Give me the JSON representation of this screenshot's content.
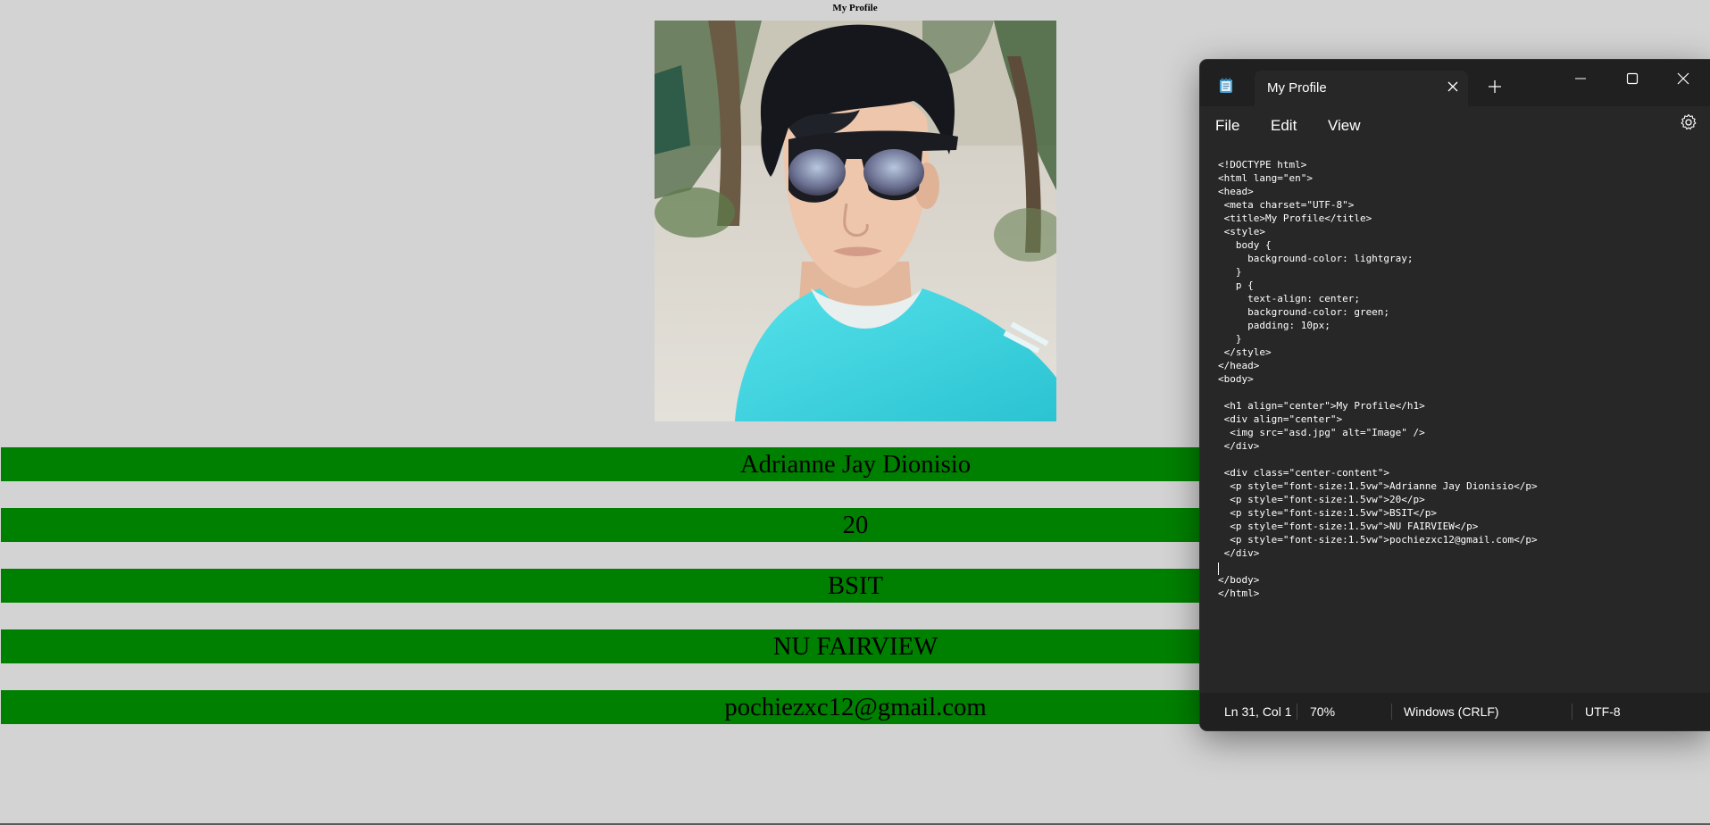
{
  "page": {
    "heading": "My Profile",
    "image_alt": "Image",
    "info": [
      "Adrianne Jay Dionisio",
      "20",
      "BSIT",
      "NU FAIRVIEW",
      "pochiezxc12@gmail.com"
    ],
    "bar_color": "#008000",
    "background_color": "#d3d3d3"
  },
  "notepad": {
    "tab_title": "My Profile",
    "icons": {
      "app": "notepad-icon",
      "tab_close": "close-icon",
      "new_tab": "plus-icon",
      "minimize": "minimize-icon",
      "maximize": "maximize-icon",
      "close": "close-icon",
      "settings": "gear-icon"
    },
    "menu": [
      "File",
      "Edit",
      "View"
    ],
    "code_lines": [
      "<!DOCTYPE html>",
      "<html lang=\"en\">",
      "<head>",
      " <meta charset=\"UTF-8\">",
      " <title>My Profile</title>",
      " <style>",
      "   body {",
      "     background-color: lightgray;",
      "   }",
      "   p {",
      "     text-align: center;",
      "     background-color: green;",
      "     padding: 10px;",
      "   }",
      " </style>",
      "</head>",
      "<body>",
      "",
      " <h1 align=\"center\">My Profile</h1>",
      " <div align=\"center\">",
      "  <img src=\"asd.jpg\" alt=\"Image\" />",
      " </div>",
      "",
      " <div class=\"center-content\">",
      "  <p style=\"font-size:1.5vw\">Adrianne Jay Dionisio</p>",
      "  <p style=\"font-size:1.5vw\">20</p>",
      "  <p style=\"font-size:1.5vw\">BSIT</p>",
      "  <p style=\"font-size:1.5vw\">NU FAIRVIEW</p>",
      "  <p style=\"font-size:1.5vw\">pochiezxc12@gmail.com</p>",
      " </div>",
      "",
      "</body>",
      "</html>"
    ],
    "status": {
      "position": "Ln 31, Col 1",
      "zoom": "70%",
      "line_ending": "Windows (CRLF)",
      "encoding": "UTF-8"
    }
  }
}
